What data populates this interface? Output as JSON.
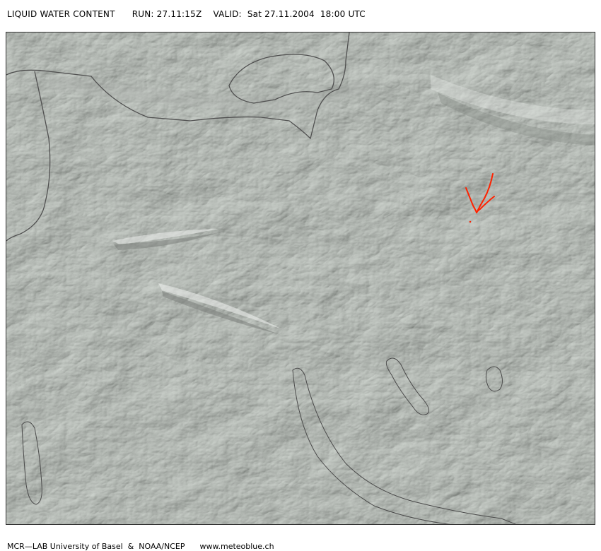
{
  "header": {
    "product": "LIQUID WATER CONTENT",
    "run": "RUN: 27.11:15Z",
    "valid": "VALID:  Sat 27.11.2004  18:00 UTC"
  },
  "map": {
    "terrain_color": "#c4c8c4",
    "highlight_color": "#e8ebe8",
    "shadow_color": "#8c908c",
    "border_color": "#505050",
    "lake_outline_color": "#4a4a4a",
    "data_color": "#ff2200"
  },
  "footer": {
    "credits": "MCR—LAB University of Basel  &  NOAA/NCEP",
    "website": "www.meteoblue.ch"
  }
}
